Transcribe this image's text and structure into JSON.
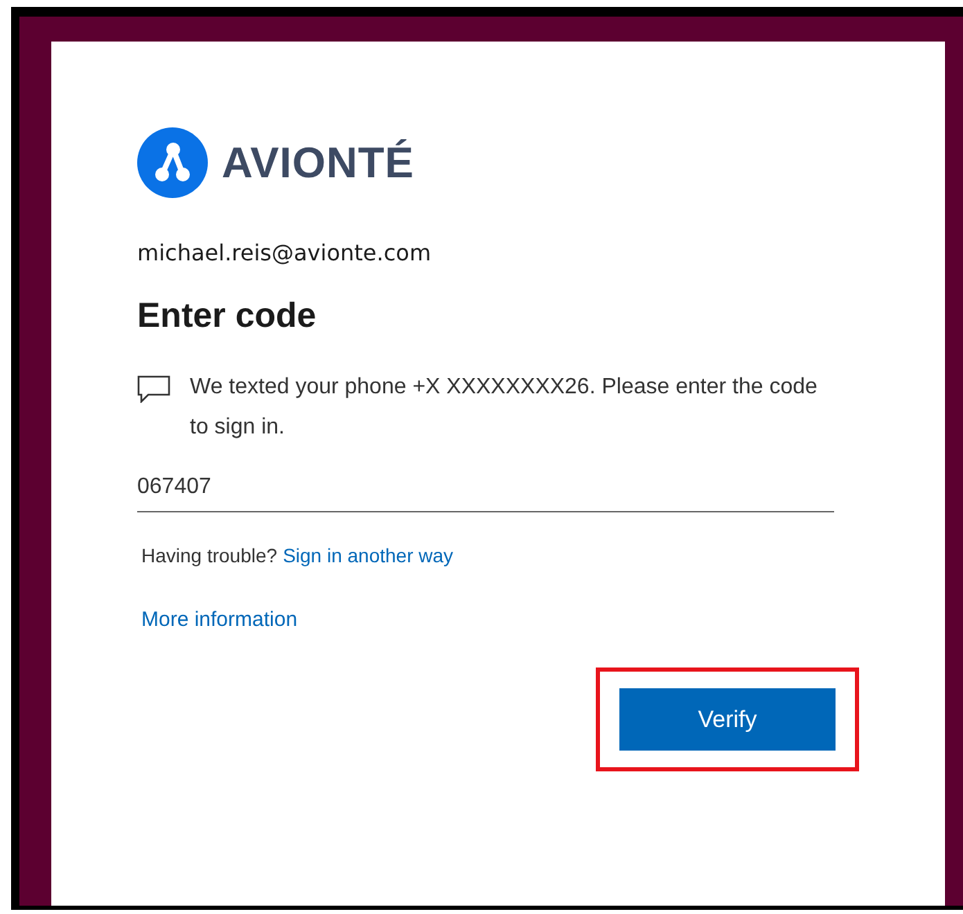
{
  "brand": {
    "name": "AVIONTÉ"
  },
  "account": "michael.reis@avionte.com",
  "title": "Enter code",
  "message": "We texted your phone +X XXXXXXXX26. Please enter the code to sign in.",
  "code_field": {
    "value": "067407"
  },
  "trouble": {
    "text": "Having trouble?",
    "link": "Sign in another way"
  },
  "more_info_link": "More information",
  "verify_button": {
    "label": "Verify",
    "highlighted": true
  }
}
